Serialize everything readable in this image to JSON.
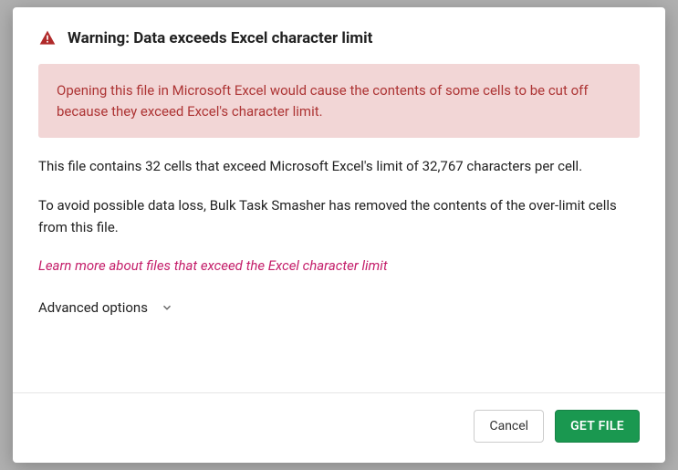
{
  "modal": {
    "title": "Warning: Data exceeds Excel character limit",
    "alert": "Opening this file in Microsoft Excel would cause the contents of some cells to be cut off because they exceed Excel's character limit.",
    "body1": "This file contains 32 cells that exceed Microsoft Excel's limit of 32,767 characters per cell.",
    "body2": "To avoid possible data loss, Bulk Task Smasher has removed the contents of the over-limit cells from this file.",
    "learn_more": "Learn more about files that exceed the Excel character limit",
    "advanced_options": "Advanced options",
    "cancel": "Cancel",
    "get_file": "GET FILE"
  }
}
